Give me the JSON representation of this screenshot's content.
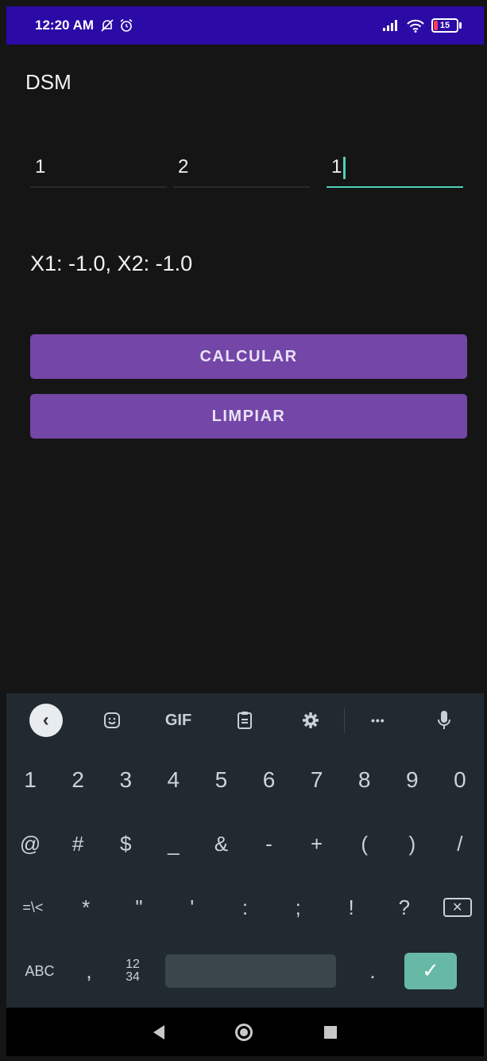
{
  "status_bar": {
    "time": "12:20 AM",
    "battery": "15"
  },
  "app": {
    "title": "DSM"
  },
  "inputs": [
    {
      "value": "1"
    },
    {
      "value": "2"
    },
    {
      "value": "1"
    }
  ],
  "result": "X1: -1.0, X2: -1.0",
  "buttons": {
    "calcular": "CALCULAR",
    "limpiar": "LIMPIAR"
  },
  "keyboard": {
    "toolbar": {
      "gif": "GIF",
      "more": "•••"
    },
    "row1": [
      "1",
      "2",
      "3",
      "4",
      "5",
      "6",
      "7",
      "8",
      "9",
      "0"
    ],
    "row2": [
      "@",
      "#",
      "$",
      "_",
      "&",
      "-",
      "+",
      "(",
      ")",
      "/"
    ],
    "row3": [
      "=\\<",
      "*",
      "\"",
      "'",
      ":",
      ";",
      "!",
      "?"
    ],
    "row4": {
      "abc": "ABC",
      "comma": ",",
      "numpad": "12\n34",
      "period": "."
    }
  },
  "colors": {
    "status_bar": "#2b0aa5",
    "button": "#7446a8",
    "accent": "#4fd1b8",
    "keyboard_bg": "#202a30",
    "enter_key": "#68b8a6"
  }
}
